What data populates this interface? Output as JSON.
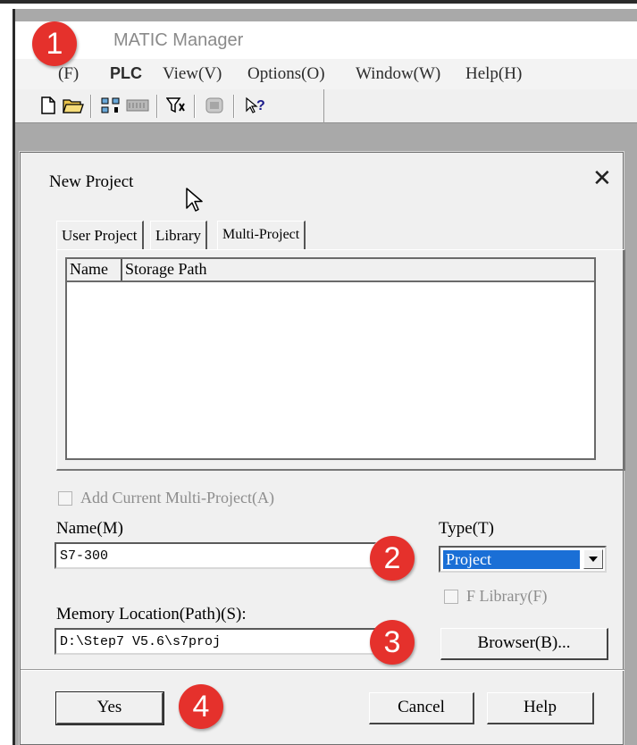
{
  "window": {
    "title": "MATIC Manager",
    "menu": [
      "(F)",
      "PLC",
      "View(V)",
      "Options(O)",
      "Window(W)",
      "Help(H)"
    ],
    "toolbar_icons": [
      "new-file-icon",
      "open-folder-icon",
      "network-icon",
      "plc-module-icon",
      "filter-icon",
      "simulation-icon",
      "help-pointer-icon"
    ]
  },
  "dialog": {
    "title": "New Project",
    "close_symbol": "✕",
    "tabs": [
      "User Project",
      "Library",
      "Multi-Project"
    ],
    "columns": [
      "Name",
      "Storage Path"
    ],
    "add_multi_project_label": "Add Current Multi-Project(A)",
    "name_label": "Name(M)",
    "name_value": "S7-300",
    "type_label": "Type(T)",
    "type_value": "Project",
    "f_library_label": "F Library(F)",
    "location_label": "Memory Location(Path)(S):",
    "location_value": "D:\\Step7 V5.6\\s7proj",
    "browser_button": "Browser(B)...",
    "yes_button": "Yes",
    "cancel_button": "Cancel",
    "help_button": "Help"
  },
  "annotations": [
    "1",
    "2",
    "3",
    "4"
  ],
  "colors": {
    "badge": "#e5312c",
    "selection": "#1a6fd6",
    "workspace": "#a9a9a9"
  }
}
